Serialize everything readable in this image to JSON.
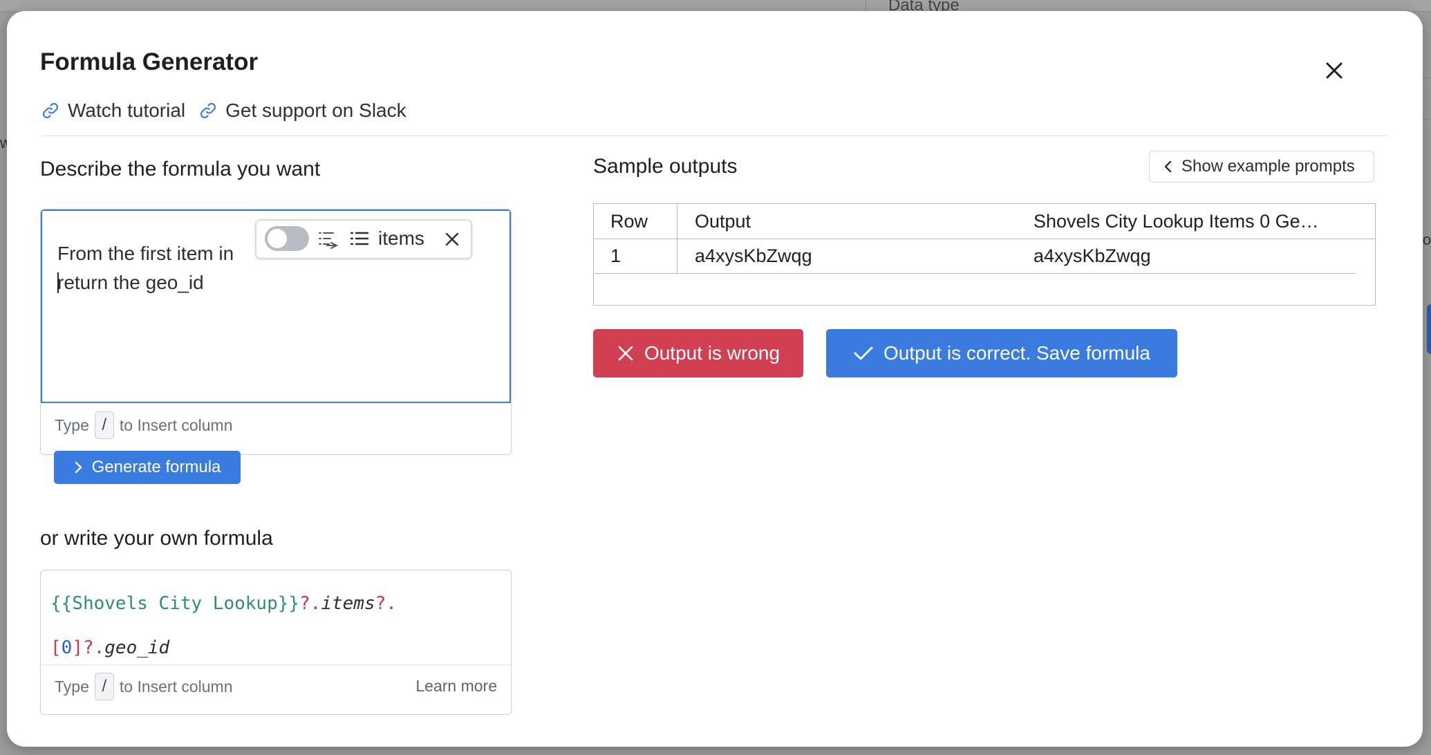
{
  "modal": {
    "title": "Formula Generator",
    "links": [
      {
        "label": "Watch tutorial",
        "icon": "link-icon"
      },
      {
        "label": "Get support on Slack",
        "icon": "link-icon"
      }
    ]
  },
  "left": {
    "describe_title": "Describe the formula you want",
    "prompt_prefix": "From the first item in",
    "chip_label": "items",
    "prompt_line2": "return the geo_id",
    "hint_type": "Type",
    "hint_key": "/",
    "hint_rest": "to Insert column",
    "generate_label": "Generate formula",
    "own_title": "or write your own formula",
    "formula": {
      "ref": "{{Shovels City Lookup}}",
      "op1": "?.",
      "prop1": "items",
      "op2": "?.",
      "bracket_open": "[",
      "index": "0",
      "bracket_close": "]",
      "op3": "?.",
      "prop2": "geo_id"
    },
    "learn_more": "Learn more"
  },
  "right": {
    "sample_title": "Sample outputs",
    "example_button": "Show example prompts",
    "table": {
      "headers": [
        "Row",
        "Output",
        "Shovels City Lookup Items 0 Ge…"
      ],
      "rows": [
        [
          "1",
          "a4xysKbZwqg",
          "a4xysKbZwqg"
        ]
      ]
    },
    "wrong_label": "Output is wrong",
    "correct_label": "Output is correct. Save formula"
  },
  "background": {
    "heading_fragment": "Data type",
    "letter_left": "w",
    "letter_right": "o"
  },
  "colors": {
    "primary": "#3a7be0",
    "danger": "#d13f53",
    "code_green": "#2e8f6b",
    "code_red": "#c2384d",
    "code_blue": "#2a5bd7"
  }
}
